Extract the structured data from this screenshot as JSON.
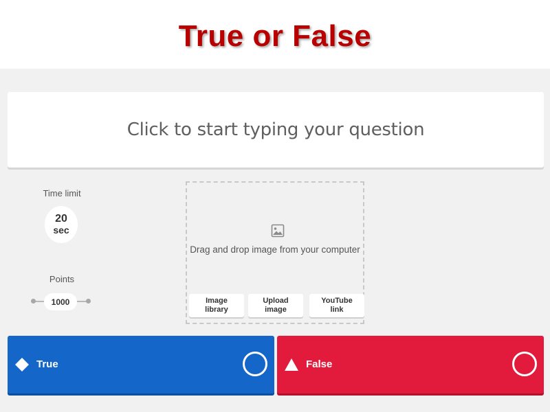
{
  "slide": {
    "title": "True or False"
  },
  "question": {
    "placeholder": "Click to start typing your question"
  },
  "settings": {
    "time_limit_label": "Time limit",
    "time_value": "20",
    "time_unit": "sec",
    "points_label": "Points",
    "points_value": "1000"
  },
  "media": {
    "icon": "image-icon",
    "drop_text": "Drag and drop image from your computer",
    "buttons": [
      {
        "label": "Image\nlibrary"
      },
      {
        "label": "Upload\nimage"
      },
      {
        "label": "YouTube\nlink"
      }
    ]
  },
  "answers": [
    {
      "label": "True",
      "shape": "diamond-icon",
      "color": "#1466c8"
    },
    {
      "label": "False",
      "shape": "triangle-icon",
      "color": "#e21b3c"
    }
  ],
  "colors": {
    "title": "#b80000",
    "true": "#1466c8",
    "false": "#e21b3c"
  }
}
